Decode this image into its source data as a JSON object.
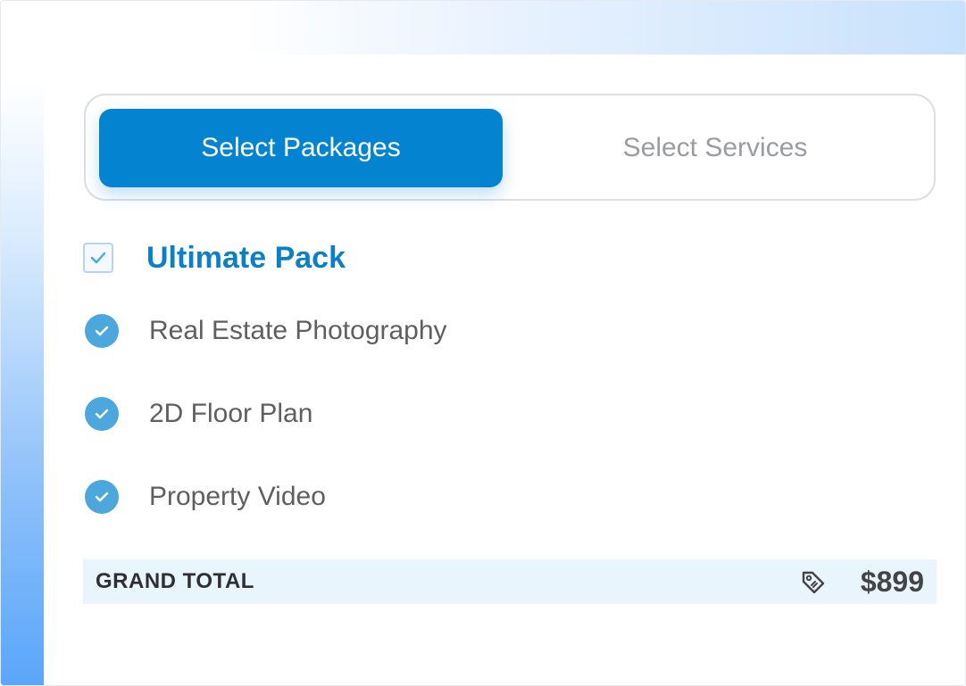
{
  "tabs": {
    "active_label": "Select Packages",
    "inactive_label": "Select Services"
  },
  "package": {
    "title": "Ultimate Pack",
    "checked": true,
    "features": [
      {
        "label": "Real Estate Photography",
        "icon": "check-circle-icon"
      },
      {
        "label": "2D Floor Plan",
        "icon": "check-circle-icon"
      },
      {
        "label": "Property Video",
        "icon": "check-circle-icon"
      }
    ]
  },
  "total": {
    "label": "GRAND TOTAL",
    "icon": "price-tag-icon",
    "amount": "$899"
  },
  "colors": {
    "accent": "#0484d0",
    "check_circle": "#4ba7dc",
    "total_bg": "#e8f5fd",
    "title": "#0b80c9"
  }
}
